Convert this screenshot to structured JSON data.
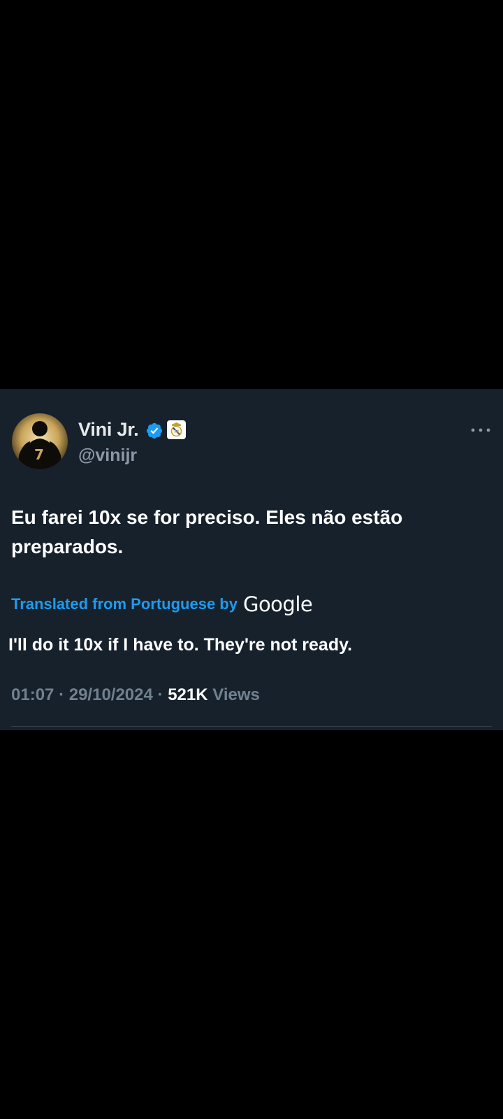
{
  "tweet": {
    "author": {
      "display_name": "Vini Jr.",
      "handle": "@vinijr",
      "verified_icon": "verified-badge-icon",
      "affiliate_icon": "real-madrid-crest-icon",
      "avatar_icon": "profile-avatar"
    },
    "more_icon": "more-horizontal-icon",
    "text": "Eu farei 10x se for preciso. Eles não estão preparados.",
    "translation": {
      "label": "Translated from Portuguese by",
      "provider": "Google",
      "text": "I'll do it 10x if I have to. They're not ready."
    },
    "meta": {
      "time": "01:07",
      "separator": "·",
      "date": "29/10/2024",
      "views_count": "521K",
      "views_label": "Views"
    }
  },
  "colors": {
    "background": "#000000",
    "card": "#17212c",
    "accent": "#1d9bf0",
    "muted": "#8b98a5",
    "text": "#ffffff"
  }
}
